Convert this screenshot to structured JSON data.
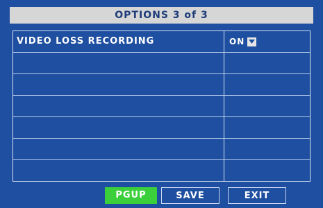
{
  "header": {
    "title": "OPTIONS 3 of 3"
  },
  "options": [
    {
      "label": "VIDEO LOSS RECORDING",
      "value": "ON"
    }
  ],
  "buttons": {
    "pgup": "PGUP",
    "save": "SAVE",
    "exit": "EXIT"
  },
  "colors": {
    "background": "#1f4fa0",
    "title_bar": "#d6d6d6",
    "title_text": "#1e3c7a",
    "active_button": "#3bcf3b",
    "grid_lines": "#bcd0ee"
  }
}
